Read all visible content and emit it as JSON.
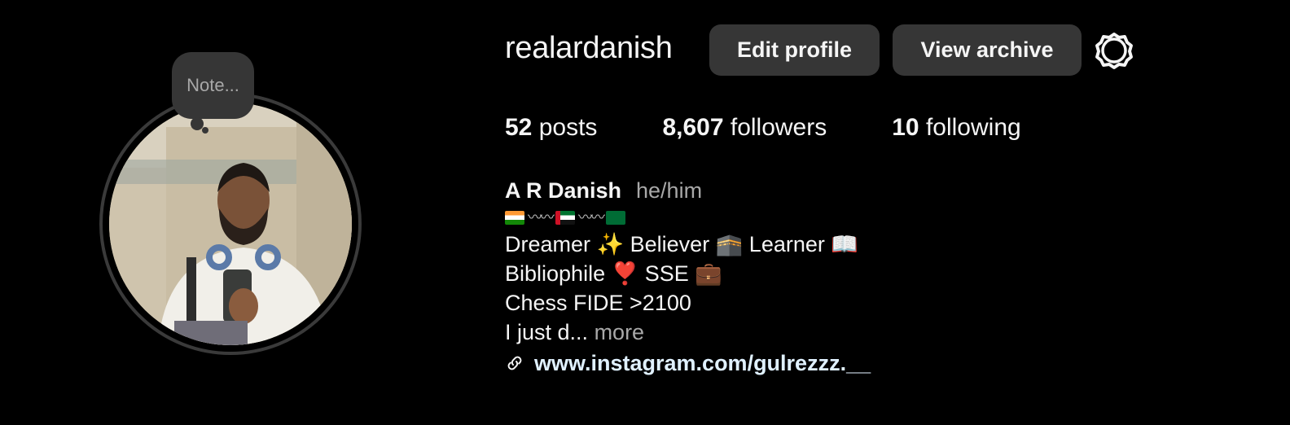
{
  "profile": {
    "username": "realardanish",
    "note_placeholder": "Note...",
    "buttons": {
      "edit": "Edit profile",
      "archive": "View archive"
    },
    "stats": [
      {
        "count": "52",
        "label": "posts"
      },
      {
        "count": "8,607",
        "label": "followers"
      },
      {
        "count": "10",
        "label": "following"
      }
    ],
    "name": "A R Danish",
    "pronouns": "he/him",
    "bio_lines": [
      "Dreamer ✨ Believer 🕋 Learner 📖",
      "Bibliophile ❣️ SSE 💼",
      "Chess FIDE >2100"
    ],
    "bio_truncated": "I just d...",
    "more_label": "more",
    "link_text": "www.instagram.com/gulrezzz.__",
    "icons": [
      "settings-gear-icon",
      "link-icon"
    ],
    "colors": {
      "background": "#000000",
      "button": "#363636",
      "secondary_text": "#a8a8a8",
      "link": "#e0f1ff"
    }
  }
}
